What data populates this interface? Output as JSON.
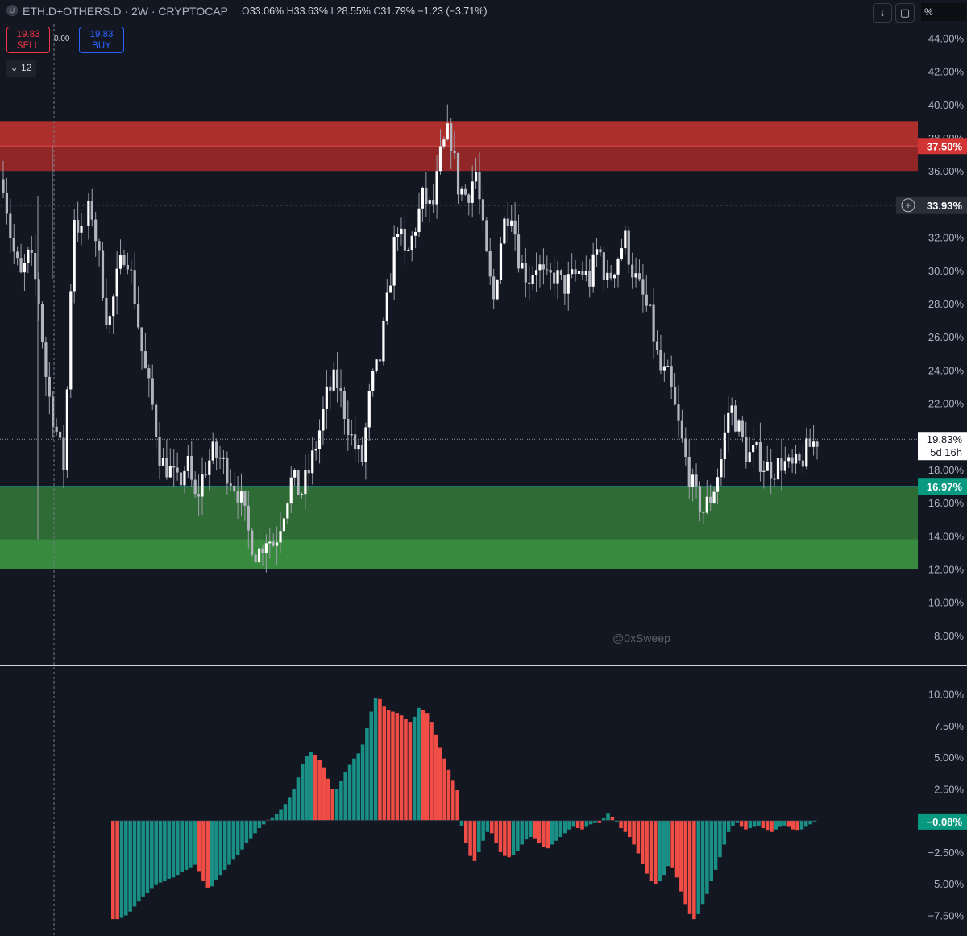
{
  "header": {
    "logo": "U",
    "symbol": "ETH.D+OTHERS.D · 2W · CRYPTOCAP",
    "ohlc": {
      "o_label": "O",
      "o": "33.06%",
      "h_label": "H",
      "h": "33.63%",
      "l_label": "L",
      "l": "28.55%",
      "c_label": "C",
      "c": "31.79%",
      "change": "−1.23 (−3.71%)"
    },
    "buttons": {
      "download_icon": "↓",
      "snapshot_icon": "▢",
      "unit": "%"
    }
  },
  "trade": {
    "sell_price": "19.83",
    "sell_label": "SELL",
    "spread": "0.00",
    "buy_price": "19.83",
    "buy_label": "BUY",
    "collapse_count": "12"
  },
  "watermark": "@0xSweep",
  "colors": {
    "bg": "#131722",
    "up": "#d1d4dc",
    "down": "#d1d4dc",
    "red_zone": "#b4302e",
    "green_zone": "#2f6b35",
    "hist_teal": "#1a8f86",
    "hist_red": "#ef4d46",
    "accent_green": "#089981",
    "accent_red": "#f23645"
  },
  "chart_data": [
    {
      "type": "candlestick",
      "title": "ETH.D+OTHERS.D · 2W · CRYPTOCAP",
      "y_unit": "%",
      "ylim": [
        6.2,
        46.3
      ],
      "y_ticks": [
        "44.00%",
        "42.00%",
        "40.00%",
        "38.00%",
        "36.00%",
        "32.00%",
        "30.00%",
        "28.00%",
        "26.00%",
        "24.00%",
        "22.00%",
        "18.00%",
        "16.00%",
        "14.00%",
        "12.00%",
        "10.00%",
        "8.00%"
      ],
      "price_labels": {
        "resistance": "37.50%",
        "crosshair": "33.93%",
        "last": "19.83%",
        "countdown": "5d 16h",
        "support": "16.97%"
      },
      "zones": [
        {
          "name": "resistance",
          "from": 36.0,
          "to": 39.0,
          "line": 37.5
        },
        {
          "name": "support",
          "from": 12.0,
          "to": 16.97,
          "line": 13.8
        }
      ],
      "close_path": [
        35.5,
        31.5,
        29.5,
        31.0,
        28.5,
        23.0,
        20.5,
        18.0,
        33.5,
        32.0,
        34.0,
        30.5,
        26.5,
        29.5,
        31.5,
        28.5,
        24.5,
        22.0,
        18.5,
        18.0,
        17.0,
        18.5,
        16.0,
        18.0,
        19.0,
        18.5,
        17.5,
        16.5,
        14.2,
        12.8,
        14.0,
        13.5,
        15.5,
        17.5,
        16.5,
        18.0,
        20.0,
        22.5,
        23.5,
        21.5,
        19.5,
        18.5,
        23.0,
        24.5,
        28.5,
        33.0,
        30.5,
        32.5,
        34.5,
        33.5,
        37.0,
        38.5,
        35.0,
        34.5,
        36.0,
        31.5,
        28.0,
        32.5,
        34.0,
        30.5,
        29.5,
        30.5,
        29.2,
        29.8,
        29.0,
        29.5,
        30.0,
        29.4,
        31.5,
        29.2,
        30.5,
        32.0,
        29.8,
        28.5,
        27.0,
        24.0,
        23.5,
        21.0,
        18.5,
        16.5,
        15.5,
        16.5,
        18.5,
        22.0,
        20.5,
        18.8,
        19.0,
        18.2,
        18.0,
        18.5,
        18.0,
        18.3,
        19.3,
        19.83
      ],
      "macd_histogram": [
        -7.8,
        -7.8,
        -7.7,
        -7.5,
        -7.2,
        -6.8,
        -6.4,
        -6.0,
        -5.7,
        -5.4,
        -5.1,
        -4.9,
        -4.8,
        -4.6,
        -4.5,
        -4.3,
        -4.1,
        -3.9,
        -3.7,
        -3.5,
        -4.0,
        -4.8,
        -5.3,
        -5.2,
        -4.7,
        -4.3,
        -3.9,
        -3.5,
        -3.1,
        -2.7,
        -2.3,
        -1.8,
        -1.4,
        -1.0,
        -0.6,
        -0.3,
        0.05,
        0.25,
        0.5,
        0.9,
        1.3,
        1.8,
        2.5,
        3.4,
        4.5,
        5.1,
        5.4,
        5.2,
        4.8,
        4.2,
        3.3,
        2.5,
        2.5,
        3.1,
        3.8,
        4.4,
        4.9,
        5.3,
        6.0,
        7.3,
        8.6,
        9.7,
        9.6,
        9.0,
        8.7,
        8.6,
        8.5,
        8.3,
        8.0,
        7.8,
        8.2,
        8.9,
        8.7,
        8.5,
        7.8,
        6.8,
        5.8,
        4.9,
        4.0,
        3.2,
        2.4,
        -0.4,
        -1.8,
        -2.8,
        -3.2,
        -2.5,
        -1.6,
        -0.9,
        -1.0,
        -1.8,
        -2.5,
        -2.8,
        -2.9,
        -2.7,
        -2.4,
        -1.9,
        -1.5,
        -1.3,
        -1.4,
        -1.8,
        -2.1,
        -2.2,
        -1.9,
        -1.6,
        -1.3,
        -1.0,
        -0.7,
        -0.5,
        -0.6,
        -0.7,
        -0.5,
        -0.3,
        -0.2,
        -0.2,
        0.2,
        0.6,
        0.3,
        -0.1,
        -0.6,
        -0.9,
        -1.3,
        -1.9,
        -2.6,
        -3.4,
        -4.2,
        -4.8,
        -5.0,
        -4.8,
        -4.3,
        -3.6,
        -3.7,
        -4.5,
        -5.6,
        -6.6,
        -7.4,
        -7.8,
        -7.4,
        -6.6,
        -5.8,
        -4.8,
        -3.9,
        -2.9,
        -1.9,
        -0.9,
        -0.4,
        -0.2,
        -0.5,
        -0.7,
        -0.6,
        -0.5,
        -0.4,
        -0.6,
        -0.8,
        -0.9,
        -0.7,
        -0.5,
        -0.4,
        -0.5,
        -0.7,
        -0.8,
        -0.7,
        -0.5,
        -0.3,
        -0.08
      ],
      "macd_ylim": [
        -9.0,
        11.5
      ],
      "macd_ticks": [
        "10.00%",
        "7.50%",
        "5.00%",
        "2.50%",
        "−2.50%",
        "−5.00%",
        "−7.50%"
      ],
      "macd_last": "−0.08%"
    }
  ]
}
